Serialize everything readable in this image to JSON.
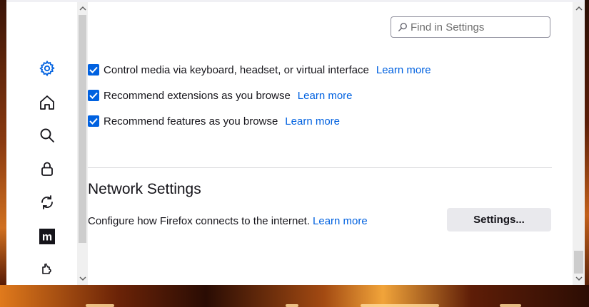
{
  "search": {
    "placeholder": "Find in Settings"
  },
  "sidebar": {
    "items": [
      {
        "icon": "gear-icon",
        "name": "General",
        "active": true
      },
      {
        "icon": "home-icon",
        "name": "Home"
      },
      {
        "icon": "search-icon",
        "name": "Search"
      },
      {
        "icon": "lock-icon",
        "name": "Privacy & Security"
      },
      {
        "icon": "sync-icon",
        "name": "Sync"
      },
      {
        "icon": "mozilla-m-icon",
        "name": "More from Mozilla"
      },
      {
        "icon": "puzzle-icon",
        "name": "Extensions & Themes"
      }
    ]
  },
  "browsing": {
    "options": [
      {
        "label": "Control media via keyboard, headset, or virtual interface",
        "checked": true,
        "link": "Learn more"
      },
      {
        "label": "Recommend extensions as you browse",
        "checked": true,
        "link": "Learn more"
      },
      {
        "label": "Recommend features as you browse",
        "checked": true,
        "link": "Learn more"
      }
    ]
  },
  "network": {
    "title": "Network Settings",
    "description": "Configure how Firefox connects to the internet.",
    "link": "Learn more",
    "button": "Settings..."
  },
  "colors": {
    "accent": "#0061e0",
    "text": "#15141a",
    "button_bg": "#e9e9ed"
  }
}
